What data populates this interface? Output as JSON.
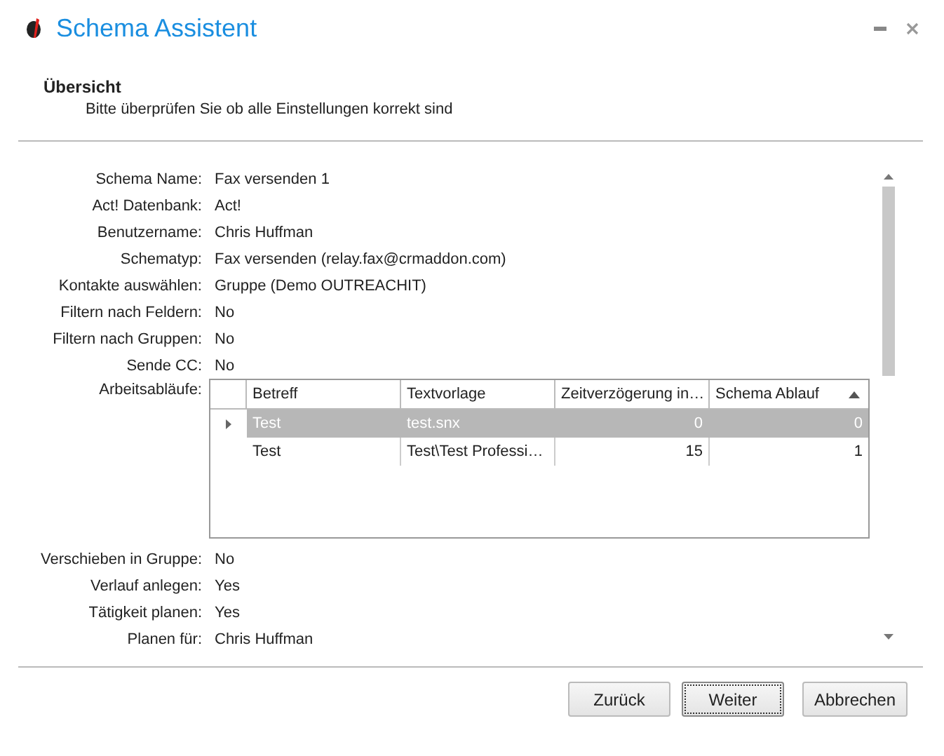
{
  "window": {
    "title": "Schema Assistent"
  },
  "header": {
    "title": "Übersicht",
    "subtitle": "Bitte überprüfen Sie ob alle Einstellungen korrekt sind"
  },
  "fields_before": [
    {
      "label": "Schema Name:",
      "value": "Fax versenden 1"
    },
    {
      "label": "Act! Datenbank:",
      "value": "Act!"
    },
    {
      "label": "Benutzername:",
      "value": "Chris Huffman"
    },
    {
      "label": "Schematyp:",
      "value": "Fax versenden (relay.fax@crmaddon.com)"
    },
    {
      "label": "Kontakte auswählen:",
      "value": "Gruppe (Demo OUTREACHIT)"
    },
    {
      "label": "Filtern nach Feldern:",
      "value": "No"
    },
    {
      "label": "Filtern nach Gruppen:",
      "value": "No"
    },
    {
      "label": "Sende CC:",
      "value": "No"
    }
  ],
  "workflows": {
    "label": "Arbeitsabläufe:",
    "columns": [
      {
        "title": "Betreff",
        "right_aligned": false,
        "sorted": false
      },
      {
        "title": "Textvorlage",
        "right_aligned": false,
        "sorted": false
      },
      {
        "title": "Zeitverzögerung in…",
        "right_aligned": true,
        "sorted": false
      },
      {
        "title": "Schema Ablauf",
        "right_aligned": true,
        "sorted": true
      }
    ],
    "rows": [
      {
        "selected": true,
        "cells": [
          "Test",
          "test.snx",
          "0",
          "0"
        ]
      },
      {
        "selected": false,
        "cells": [
          "Test",
          "Test\\Test Professi…",
          "15",
          "1"
        ]
      }
    ]
  },
  "fields_after": [
    {
      "label": "Verschieben in Gruppe:",
      "value": "No"
    },
    {
      "label": "Verlauf anlegen:",
      "value": "Yes"
    },
    {
      "label": "Tätigkeit planen:",
      "value": "Yes"
    },
    {
      "label": "Planen für:",
      "value": "Chris Huffman"
    }
  ],
  "buttons": [
    {
      "label": "Zurück",
      "focused": false
    },
    {
      "label": "Weiter",
      "focused": true
    },
    {
      "label": "Abbrechen",
      "focused": false
    }
  ]
}
